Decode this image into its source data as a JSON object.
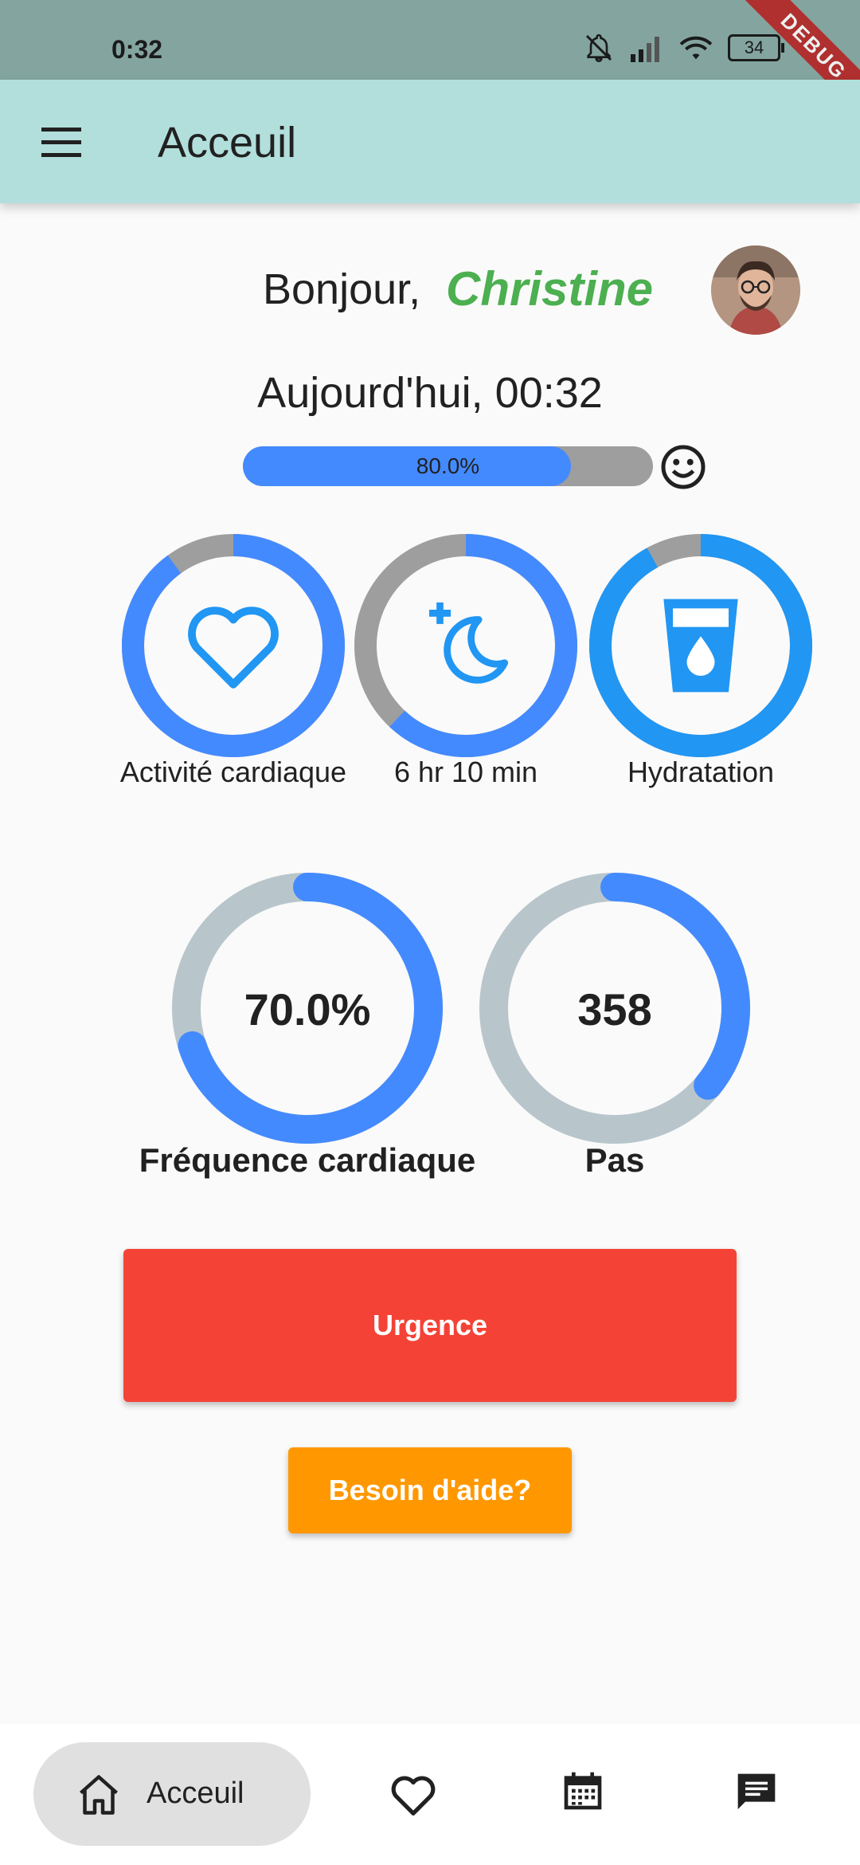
{
  "status_bar": {
    "time": "0:32",
    "battery": "34",
    "debug_banner": "DEBUG"
  },
  "app_bar": {
    "title": "Acceuil"
  },
  "greeting": {
    "prefix": "Bonjour,",
    "name": "Christine"
  },
  "date_line": "Aujourd'hui, 00:32",
  "daily_progress": {
    "label": "80.0%",
    "value": 0.8
  },
  "activity_rings": [
    {
      "label": "Activité cardiaque",
      "icon": "heart-icon",
      "value": 0.9
    },
    {
      "label": "6 hr 10 min",
      "icon": "sleep-moon-icon",
      "value": 0.62
    },
    {
      "label": "Hydratation",
      "icon": "water-glass-icon",
      "value": 0.92
    }
  ],
  "metrics": [
    {
      "value_label": "70.0%",
      "label": "Fréquence cardiaque",
      "value": 0.7
    },
    {
      "value_label": "358",
      "label": "Pas",
      "value": 0.36
    }
  ],
  "buttons": {
    "urgence": "Urgence",
    "help": "Besoin d'aide?"
  },
  "bottom_nav": {
    "home_label": "Acceuil",
    "items": [
      "home-icon",
      "heart-outline-icon",
      "calendar-icon",
      "chat-icon"
    ]
  },
  "colors": {
    "app_bar": "#b2dfdb",
    "accent_blue": "#448aff",
    "ring_blue": "#2196f3",
    "track_grey": "#9e9e9e",
    "track_bluegrey": "#b8c6cc",
    "name_green": "#4caf50",
    "urgence_red": "#f44336",
    "help_orange": "#ff9800"
  }
}
